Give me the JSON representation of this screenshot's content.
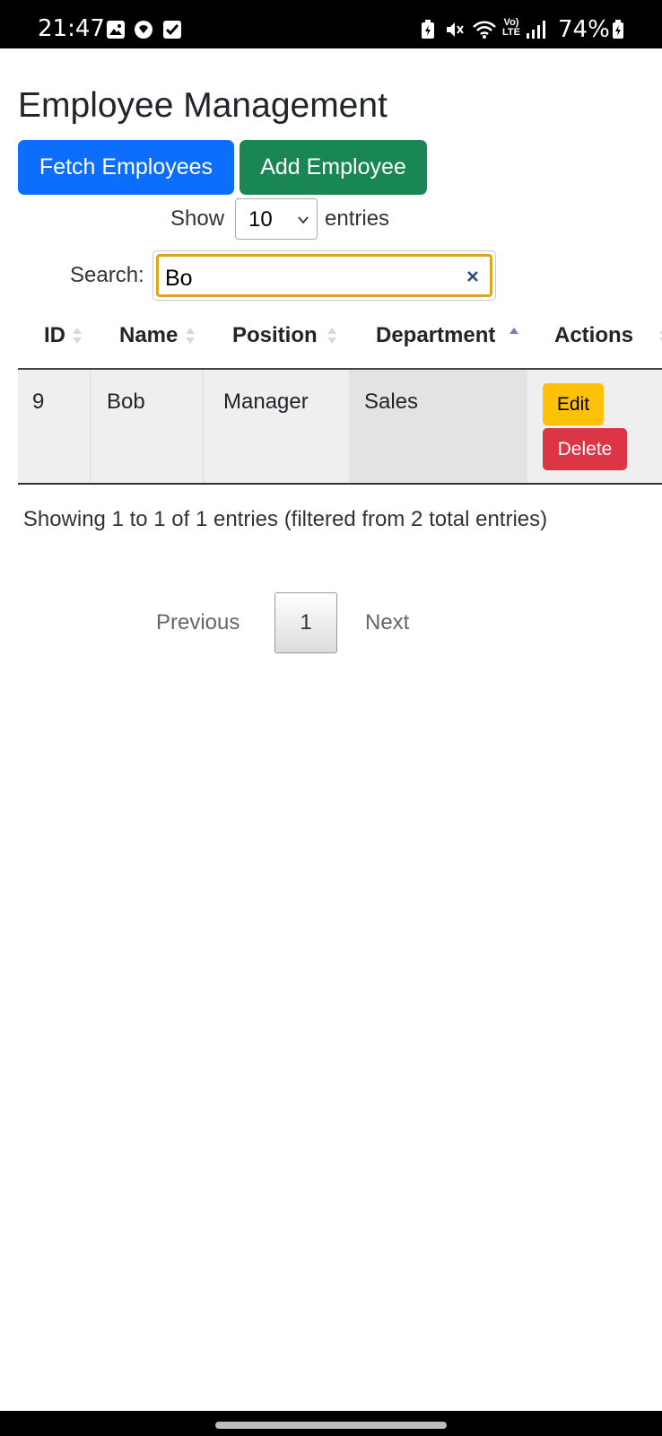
{
  "status_bar": {
    "time": "21:47",
    "battery_percent": "74%",
    "left_icons": [
      "gallery-icon",
      "messenger-icon",
      "checkbox-icon"
    ],
    "right_icons": [
      "battery-saver-icon",
      "mute-icon",
      "wifi-icon",
      "volte-icon",
      "signal-icon",
      "battery-icon"
    ],
    "volte_label": "Vo) LTE"
  },
  "page": {
    "title": "Employee Management",
    "fetch_button": "Fetch Employees",
    "add_button": "Add Employee"
  },
  "length": {
    "show_label": "Show",
    "selected": "10",
    "entries_label": "entries"
  },
  "search": {
    "label": "Search:",
    "value": "Bo"
  },
  "table": {
    "columns": [
      "ID",
      "Name",
      "Position",
      "Department",
      "Actions"
    ],
    "sorted_column": "Department",
    "sort_direction": "ascending",
    "rows": [
      {
        "id": "9",
        "name": "Bob",
        "position": "Manager",
        "department": "Sales",
        "edit": "Edit",
        "delete": "Delete"
      }
    ]
  },
  "info": {
    "text": "Showing 1 to 1 of 1 entries (filtered from 2 total entries)"
  },
  "pagination": {
    "previous": "Previous",
    "current": "1",
    "next": "Next"
  },
  "colors": {
    "primary": "#0d6efd",
    "success": "#198754",
    "warning": "#ffc107",
    "danger": "#dc3545",
    "focus": "#e0a41c"
  }
}
